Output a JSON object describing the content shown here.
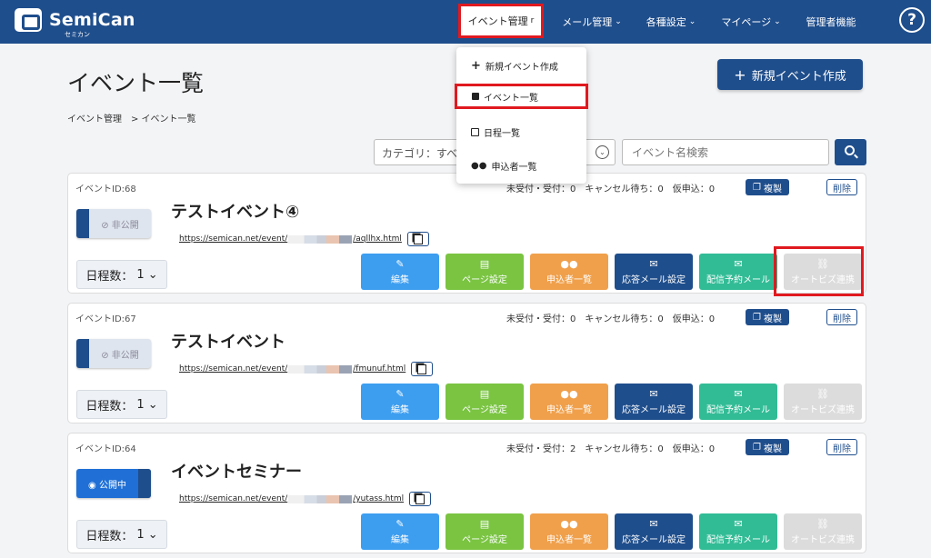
{
  "header": {
    "logo_name": "SemiCan",
    "logo_sub": "セミカン",
    "nav": [
      {
        "label": "イベント管理",
        "chev": "r"
      },
      {
        "label": "メール管理",
        "chev": "⌄"
      },
      {
        "label": "各種設定",
        "chev": "⌄"
      },
      {
        "label": "マイページ",
        "chev": "⌄"
      },
      {
        "label": "管理者機能",
        "chev": ""
      }
    ],
    "help": "?"
  },
  "dropdown": {
    "items": [
      {
        "label": "新規イベント作成",
        "icon": "plus-icon"
      },
      {
        "label": "イベント一覧",
        "icon": "calendar-icon"
      },
      {
        "label": "日程一覧",
        "icon": "calendar-grid-icon"
      },
      {
        "label": "申込者一覧",
        "icon": "users-icon"
      }
    ]
  },
  "page": {
    "title": "イベント一覧",
    "breadcrumb": "イベント管理　>  イベント一覧",
    "create_button": "新規イベント作成",
    "category_placeholder": "カテゴリ：すべて",
    "search_placeholder": "イベント名検索"
  },
  "labels": {
    "copy": "複製",
    "delete": "削除",
    "schedule_prefix": "日程数：",
    "actions": [
      "編集",
      "ページ設定",
      "申込者一覧",
      "応答メール設定",
      "配信予約メール",
      "オートビズ連携"
    ]
  },
  "events": [
    {
      "id_text": "イベントID:68",
      "stats": "未受付・受付：0　キャンセル待ち：0　仮申込：0",
      "status": "非公開",
      "title": "テストイベント④",
      "url_prefix": "https://semican.net/event/",
      "url_suffix": "/aqllhx.html",
      "schedule_count": "1"
    },
    {
      "id_text": "イベントID:67",
      "stats": "未受付・受付：0　キャンセル待ち：0　仮申込：0",
      "status": "非公開",
      "title": "テストイベント",
      "url_prefix": "https://semican.net/event/",
      "url_suffix": "/fmunuf.html",
      "schedule_count": "1"
    },
    {
      "id_text": "イベントID:64",
      "stats": "未受付・受付：2　キャンセル待ち：0　仮申込：0",
      "status": "公開中",
      "title": "イベントセミナー",
      "url_prefix": "https://semican.net/event/",
      "url_suffix": "/yutass.html",
      "schedule_count": "1"
    }
  ],
  "colors": {
    "brand": "#1f4e8c",
    "highlight": "#e0191f",
    "edit": "#3d9ef0",
    "page": "#7ac442",
    "applicants": "#f0a04b",
    "reply_mail": "#1f4e8c",
    "scheduled_mail": "#32bc96",
    "autobiz": "#dcdcdc"
  }
}
